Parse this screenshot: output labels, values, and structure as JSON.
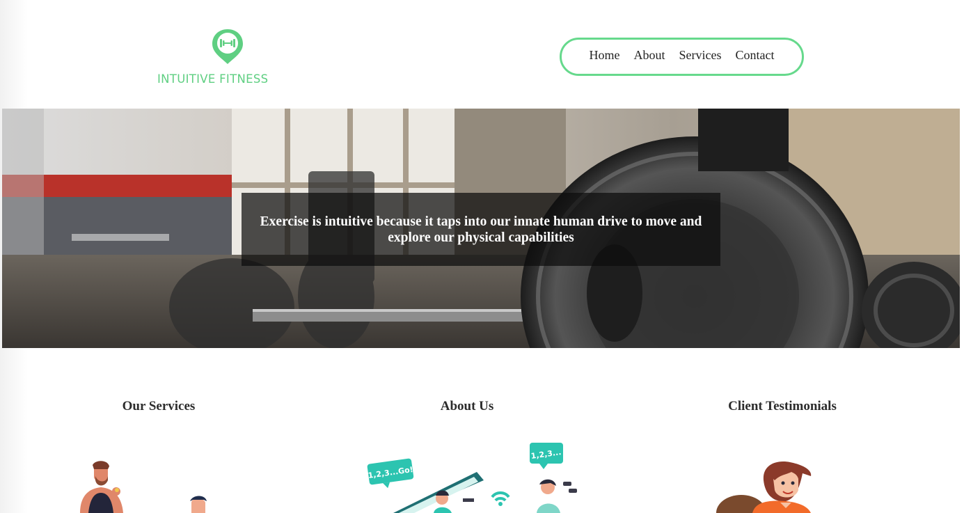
{
  "brand": {
    "name": "INTUITIVE FITNESS",
    "accent_color": "#5fcf82",
    "logo_icon": "map-pin-dumbbell-icon"
  },
  "nav": {
    "items": [
      {
        "label": "Home"
      },
      {
        "label": "About"
      },
      {
        "label": "Services"
      },
      {
        "label": "Contact"
      }
    ],
    "border_color": "#66d98c"
  },
  "hero": {
    "image": "gym-barbell-weight-plates-photo",
    "tagline": "Exercise is intuitive because it taps into our innate human drive to move and explore our physical capabilities"
  },
  "sections": [
    {
      "title": "Our Services",
      "illustration": "people-exercising-illustration"
    },
    {
      "title": "About Us",
      "illustration": "online-workout-illustration"
    },
    {
      "title": "Client Testimonials",
      "illustration": "smiling-woman-illustration"
    }
  ],
  "illustration_text": {
    "bubble_left": "1,2,3...Go!",
    "bubble_right": "1,2,3..."
  }
}
